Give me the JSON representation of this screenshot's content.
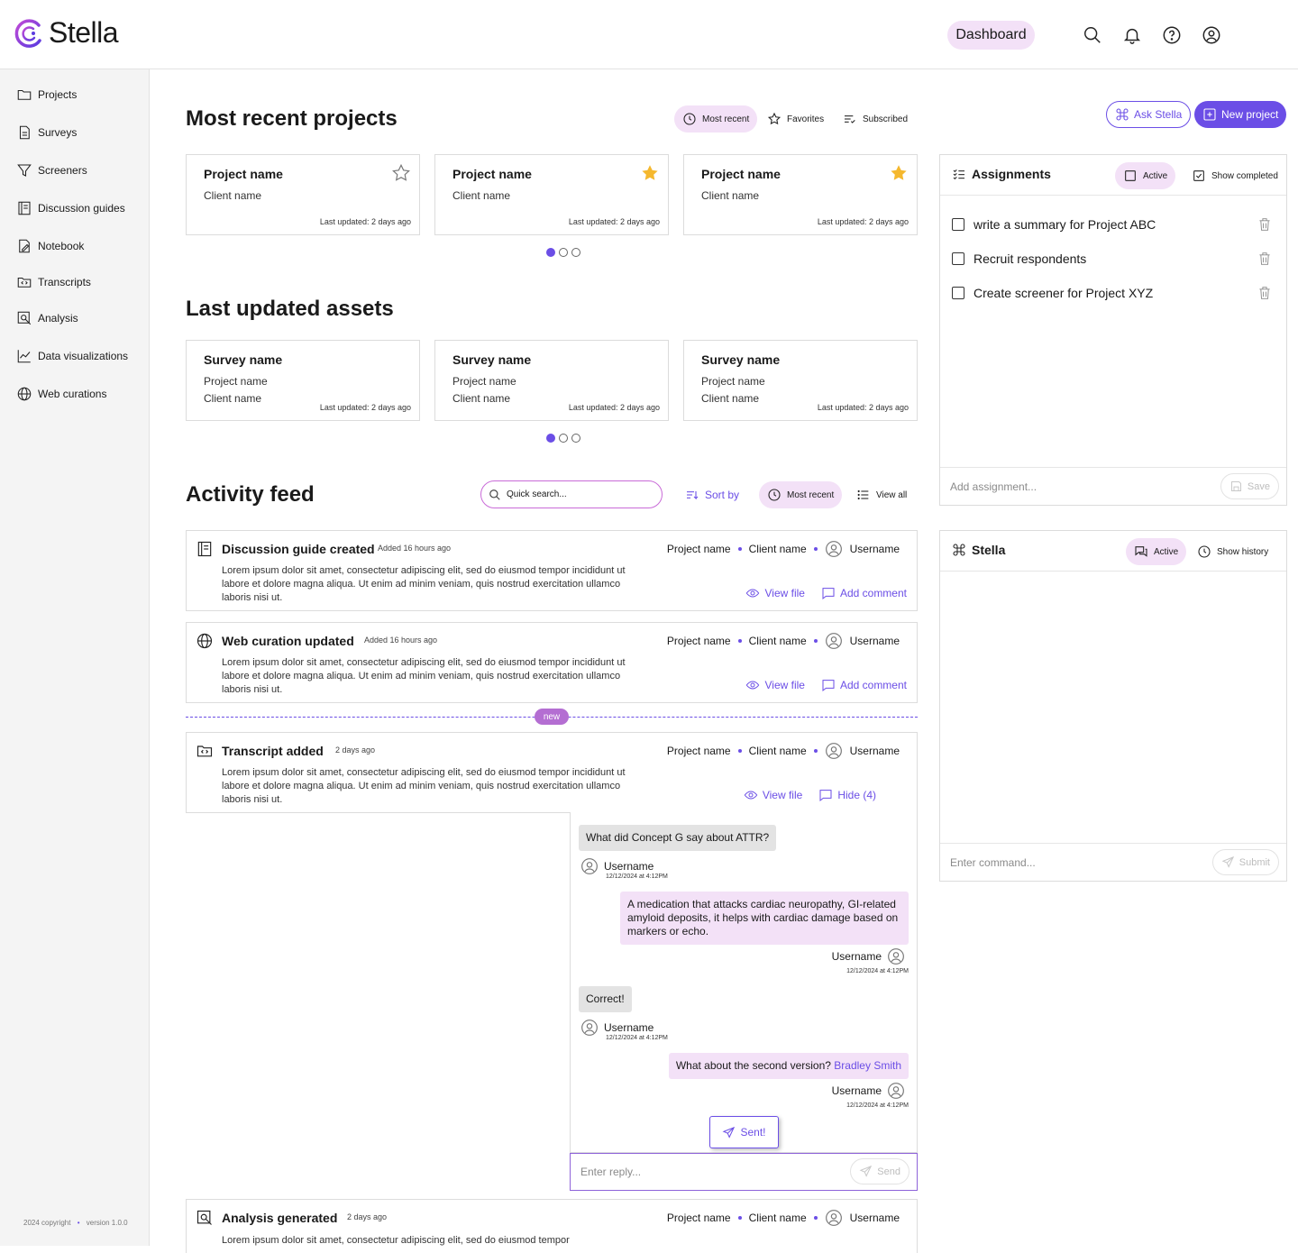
{
  "app": {
    "name": "Stella",
    "footer_copyright": "2024 copyright",
    "footer_version": "version 1.0.0"
  },
  "header": {
    "dashboard_label": "Dashboard"
  },
  "sidebar": {
    "items": [
      {
        "label": "Projects",
        "icon": "folder-icon"
      },
      {
        "label": "Surveys",
        "icon": "document-icon"
      },
      {
        "label": "Screeners",
        "icon": "filter-icon"
      },
      {
        "label": "Discussion guides",
        "icon": "guide-icon"
      },
      {
        "label": "Notebook",
        "icon": "notebook-icon"
      },
      {
        "label": "Transcripts",
        "icon": "transcript-icon"
      },
      {
        "label": "Analysis",
        "icon": "analysis-icon"
      },
      {
        "label": "Data visualizations",
        "icon": "chart-icon"
      },
      {
        "label": "Web curations",
        "icon": "globe-icon"
      }
    ]
  },
  "projects": {
    "title": "Most recent projects",
    "filters": {
      "most_recent": "Most recent",
      "favorites": "Favorites",
      "subscribed": "Subscribed"
    },
    "ask_stella": "Ask Stella",
    "new_project": "New project",
    "cards": [
      {
        "title": "Project name",
        "client": "Client name",
        "updated": "Last updated: 2 days ago",
        "favorite": false
      },
      {
        "title": "Project name",
        "client": "Client name",
        "updated": "Last updated: 2 days ago",
        "favorite": true
      },
      {
        "title": "Project name",
        "client": "Client name",
        "updated": "Last updated: 2 days ago",
        "favorite": true
      }
    ],
    "page": 1,
    "pages": 3
  },
  "assets": {
    "title": "Last updated assets",
    "cards": [
      {
        "title": "Survey name",
        "project": "Project name",
        "client": "Client name",
        "updated": "Last updated: 2 days ago"
      },
      {
        "title": "Survey name",
        "project": "Project name",
        "client": "Client name",
        "updated": "Last updated: 2 days ago"
      },
      {
        "title": "Survey name",
        "project": "Project name",
        "client": "Client name",
        "updated": "Last updated: 2 days ago"
      }
    ],
    "page": 1,
    "pages": 3
  },
  "activity": {
    "title": "Activity feed",
    "search_placeholder": "Quick search...",
    "sort_by": "Sort by",
    "most_recent": "Most recent",
    "view_all": "View all",
    "new_label": "new",
    "items": [
      {
        "title": "Discussion guide created",
        "ago": "Added 16 hours ago",
        "icon": "guide-icon",
        "project": "Project name",
        "client": "Client name",
        "user": "Username",
        "body": "Lorem ipsum dolor sit amet, consectetur adipiscing elit, sed do eiusmod tempor incididunt ut labore et dolore magna aliqua. Ut enim ad minim veniam, quis nostrud exercitation ullamco laboris nisi ut.",
        "view": "View file",
        "comment": "Add comment"
      },
      {
        "title": "Web curation updated",
        "ago": "Added 16 hours ago",
        "icon": "globe-icon",
        "project": "Project name",
        "client": "Client name",
        "user": "Username",
        "body": "Lorem ipsum dolor sit amet, consectetur adipiscing elit, sed do eiusmod tempor incididunt ut labore et dolore magna aliqua. Ut enim ad minim veniam, quis nostrud exercitation ullamco laboris nisi ut.",
        "view": "View file",
        "comment": "Add comment"
      },
      {
        "title": "Transcript added",
        "ago": "2 days ago",
        "icon": "transcript-icon",
        "project": "Project name",
        "client": "Client name",
        "user": "Username",
        "body": "Lorem ipsum dolor sit amet, consectetur adipiscing elit, sed do eiusmod tempor incididunt ut labore et dolore magna aliqua. Ut enim ad minim veniam, quis nostrud exercitation ullamco laboris nisi ut.",
        "view": "View file",
        "comment": "Hide (4)"
      },
      {
        "title": "Analysis generated",
        "ago": "2 days ago",
        "icon": "analysis-icon",
        "project": "Project name",
        "client": "Client name",
        "user": "Username",
        "body": "Lorem ipsum dolor sit amet, consectetur adipiscing elit, sed do eiusmod tempor"
      }
    ],
    "thread": {
      "messages": [
        {
          "text": "What did Concept G say about ATTR?",
          "user": "Username",
          "time": "12/12/2024 at 4:12PM"
        },
        {
          "text": "A medication that attacks cardiac neuropathy, GI-related amyloid deposits, it helps with cardiac damage based on markers or echo.",
          "user": "Username",
          "time": "12/12/2024 at 4:12PM"
        },
        {
          "text": "Correct!",
          "user": "Username",
          "time": "12/12/2024 at 4:12PM"
        },
        {
          "text": "What about the second version?",
          "mention": "Bradley Smith",
          "user": "Username",
          "time": "12/12/2024 at 4:12PM"
        }
      ],
      "sent_label": "Sent!",
      "reply_placeholder": "Enter reply...",
      "send_label": "Send"
    }
  },
  "assignments": {
    "title": "Assignments",
    "active": "Active",
    "show_completed": "Show completed",
    "items": [
      "write a summary for Project ABC",
      "Recruit respondents",
      "Create screener for Project XYZ"
    ],
    "add_placeholder": "Add assignment...",
    "save": "Save"
  },
  "stella": {
    "title": "Stella",
    "active": "Active",
    "show_history": "Show history",
    "command_placeholder": "Enter command...",
    "submit": "Submit"
  },
  "colors": {
    "accent": "#6b4ee6",
    "pink": "#f3e1f7",
    "star": "#f5b82e"
  }
}
